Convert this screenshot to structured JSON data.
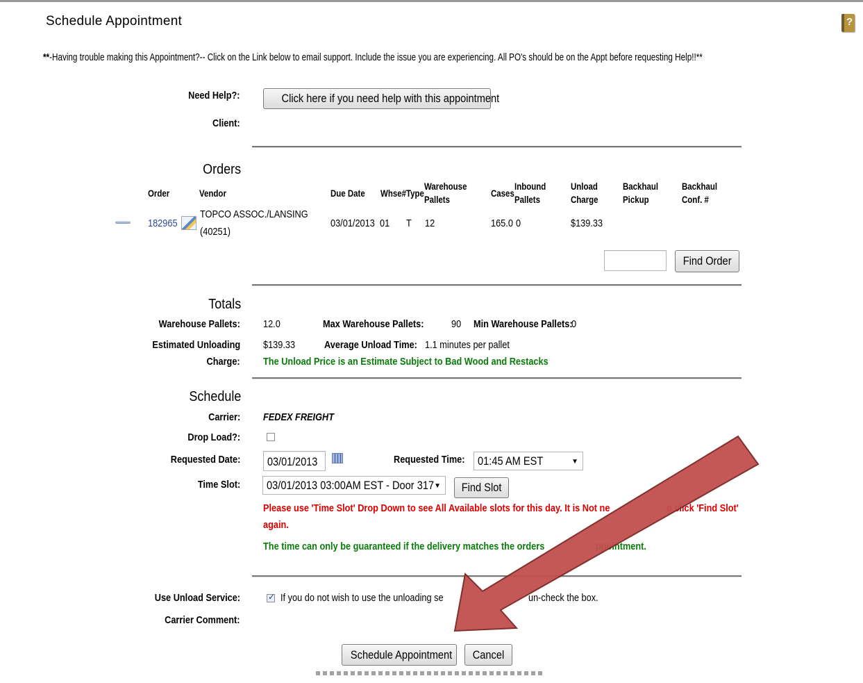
{
  "header": {
    "title": "Schedule Appointment",
    "notice_prefix": "**",
    "notice": "-Having trouble making this Appointment?-- Click on the Link below to email support. Include the issue you are experiencing. All PO's should be on the Appt before requesting Help!!**",
    "help_icon": "book-help-icon"
  },
  "help": {
    "label": "Need Help?:",
    "button": "Click here if you need help with this appointment",
    "client_label": "Client:"
  },
  "orders": {
    "title": "Orders",
    "columns": {
      "order": "Order",
      "vendor": "Vendor",
      "due_date": "Due Date",
      "whse": "Whse#",
      "type": "Type",
      "warehouse_pallets": "Warehouse Pallets",
      "cases": "Cases",
      "inbound_pallets": "Inbound Pallets",
      "unload_charge": "Unload Charge",
      "backhaul_pickup": "Backhaul Pickup",
      "backhaul_conf": "Backhaul Conf. #"
    },
    "rows": [
      {
        "order": "182965",
        "vendor_line1": "TOPCO ASSOC./LANSING",
        "vendor_line2": "(40251)",
        "due_date": "03/01/2013",
        "whse": "01",
        "type": "T",
        "warehouse_pallets": "12",
        "cases": "165.0",
        "inbound_pallets": "0",
        "unload_charge": "$139.33"
      }
    ],
    "find_order_input": "",
    "find_order_button": "Find Order"
  },
  "totals": {
    "title": "Totals",
    "warehouse_pallets_label": "Warehouse Pallets:",
    "warehouse_pallets": "12.0",
    "max_label": "Max Warehouse Pallets:",
    "max_value": "90",
    "min_label": "Min Warehouse Pallets:",
    "min_value": "0",
    "est_label_1": "Estimated Unloading",
    "est_label_2": "Charge:",
    "est_value": "$139.33",
    "avg_label": "Average Unload Time:",
    "avg_value": "1.1 minutes per pallet",
    "estimate_note": "The Unload Price is an Estimate Subject to Bad Wood and Restacks"
  },
  "schedule": {
    "title": "Schedule",
    "carrier_label": "Carrier:",
    "carrier": "FEDEX FREIGHT",
    "drop_load_label": "Drop Load?:",
    "requested_date_label": "Requested Date:",
    "requested_date": "03/01/2013",
    "requested_time_label": "Requested Time:",
    "requested_time": "01:45 AM EST",
    "time_slot_label": "Time Slot:",
    "time_slot": "03/01/2013 03:00AM EST - Door 317",
    "find_slot_button": "Find Slot",
    "warning_line1": "Please use 'Time Slot' Drop Down to see All Available slots for this day. It is Not ne",
    "warning_line1_end": "o click 'Find Slot'",
    "warning_line2": "again.",
    "guarantee_note_a": "The time can only be guaranteed if the delivery matches the orders",
    "guarantee_note_b": "ppointment."
  },
  "unload": {
    "label": "Use Unload Service:",
    "text_a": "If you do not wish to use the unloading se",
    "text_b": "un-check the box.",
    "carrier_comment_label": "Carrier Comment:"
  },
  "actions": {
    "schedule_button": "Schedule Appointment",
    "cancel_button": "Cancel"
  },
  "annotation": {
    "arrow_color": "#c0504d"
  }
}
